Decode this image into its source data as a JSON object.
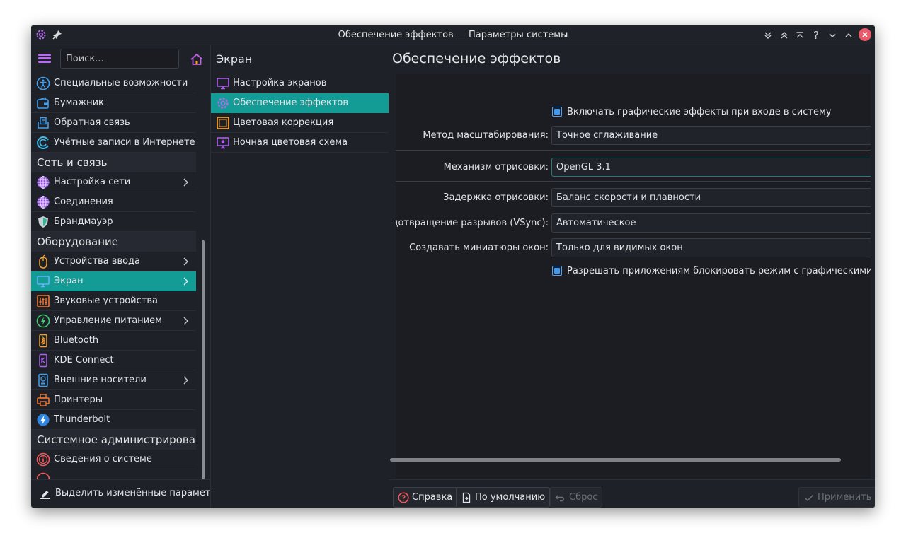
{
  "window": {
    "title": "Обеспечение эффектов — Параметры системы",
    "accent_color": "#139c95",
    "control_icons": [
      "keep-below-icon",
      "keep-above-icon",
      "shade-icon",
      "help-icon",
      "minimize-icon",
      "maximize-icon",
      "close-icon"
    ]
  },
  "sidebar": {
    "search_placeholder": "Поиск...",
    "items": [
      {
        "type": "item",
        "label": "Специальные возможности",
        "icon": "accessibility-icon"
      },
      {
        "type": "item",
        "label": "Бумажник",
        "icon": "wallet-icon"
      },
      {
        "type": "item",
        "label": "Обратная связь",
        "icon": "feedback-icon"
      },
      {
        "type": "item",
        "label": "Учётные записи в Интернете",
        "icon": "online-accounts-icon"
      },
      {
        "type": "category",
        "label": "Сеть и связь"
      },
      {
        "type": "item",
        "label": "Настройка сети",
        "icon": "globe-icon",
        "chevron": true
      },
      {
        "type": "item",
        "label": "Соединения",
        "icon": "globe-icon"
      },
      {
        "type": "item",
        "label": "Брандмауэр",
        "icon": "shield-icon"
      },
      {
        "type": "category",
        "label": "Оборудование"
      },
      {
        "type": "item",
        "label": "Устройства ввода",
        "icon": "mouse-icon",
        "chevron": true
      },
      {
        "type": "item",
        "label": "Экран",
        "icon": "monitor-icon",
        "chevron": true,
        "active": true
      },
      {
        "type": "item",
        "label": "Звуковые устройства",
        "icon": "audio-mixer-icon"
      },
      {
        "type": "item",
        "label": "Управление питанием",
        "icon": "power-icon",
        "chevron": true
      },
      {
        "type": "item",
        "label": "Bluetooth",
        "icon": "bluetooth-icon"
      },
      {
        "type": "item",
        "label": "KDE Connect",
        "icon": "kde-connect-icon"
      },
      {
        "type": "item",
        "label": "Внешние носители",
        "icon": "removable-media-icon",
        "chevron": true
      },
      {
        "type": "item",
        "label": "Принтеры",
        "icon": "printer-icon"
      },
      {
        "type": "item",
        "label": "Thunderbolt",
        "icon": "thunderbolt-icon"
      },
      {
        "type": "category",
        "label": "Системное администрировани"
      },
      {
        "type": "item",
        "label": "Сведения о системе",
        "icon": "info-icon"
      }
    ],
    "bottom_label": "Выделить изменённые параметры"
  },
  "middle": {
    "header": "Экран",
    "items": [
      {
        "label": "Настройка экранов",
        "icon": "monitor-icon"
      },
      {
        "label": "Обеспечение эффектов",
        "icon": "gear-icon",
        "active": true
      },
      {
        "label": "Цветовая коррекция",
        "icon": "color-correction-icon"
      },
      {
        "label": "Ночная цветовая схема",
        "icon": "night-color-icon"
      }
    ]
  },
  "content": {
    "title": "Обеспечение эффектов",
    "enable_effects_label": "Включать графические эффекты при входе в систему",
    "scale_method_label": "Метод масштабирования:",
    "scale_method_value": "Точное сглаживание",
    "backend_label": "Механизм отрисовки:",
    "backend_value": "OpenGL 3.1",
    "latency_label": "Задержка отрисовки:",
    "latency_value": "Баланс скорости и плавности",
    "tearing_label": "Предотвращение разрывов (VSync):",
    "tearing_value": "Автоматическое",
    "thumbnails_label": "Создавать миниатюры окон:",
    "thumbnails_value": "Только для видимых окон",
    "allow_block_label": "Разрешать приложениям блокировать режим с графическими эффекта"
  },
  "buttons": {
    "help": "Справка",
    "defaults": "По умолчанию",
    "reset": "Сброс",
    "apply": "Применить"
  }
}
